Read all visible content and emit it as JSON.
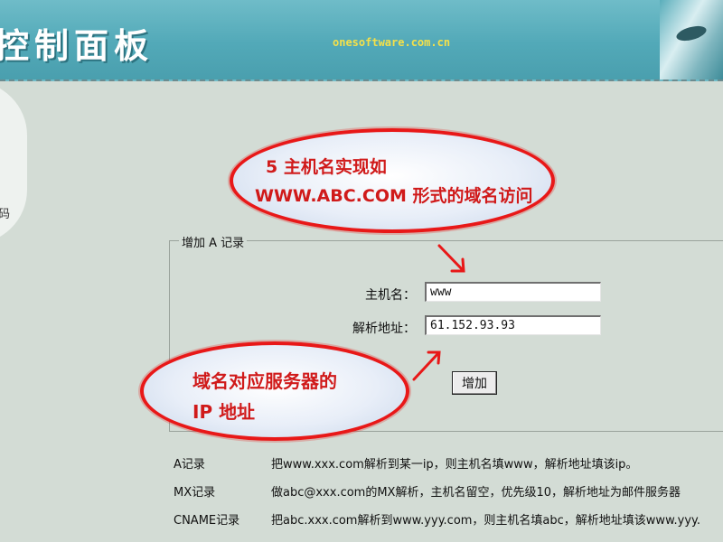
{
  "header": {
    "title": "控制面板",
    "site": "onesoftware.com.cn"
  },
  "left_note": "码",
  "annotations": {
    "top_line1": "5 主机名实现如",
    "top_line2": "WWW.ABC.COM 形式的域名访问",
    "bottom_line1": "域名对应服务器的",
    "bottom_line2": "IP 地址"
  },
  "form": {
    "legend": "增加 A 记录",
    "host_label": "主机名：",
    "host_value": "www",
    "ip_label": "解析地址：",
    "ip_value": "61.152.93.93",
    "submit_label": "增加"
  },
  "records": [
    {
      "type": "A记录",
      "desc": "把www.xxx.com解析到某一ip，则主机名填www，解析地址填该ip。"
    },
    {
      "type": "MX记录",
      "desc": "做abc@xxx.com的MX解析，主机名留空，优先级10，解析地址为邮件服务器"
    },
    {
      "type": "CNAME记录",
      "desc": "把abc.xxx.com解析到www.yyy.com，则主机名填abc，解析地址填该www.yyy."
    }
  ],
  "colors": {
    "header_teal": "#52a9b8",
    "annotation_red": "#e81818",
    "site_yellow": "#f4e04a"
  }
}
